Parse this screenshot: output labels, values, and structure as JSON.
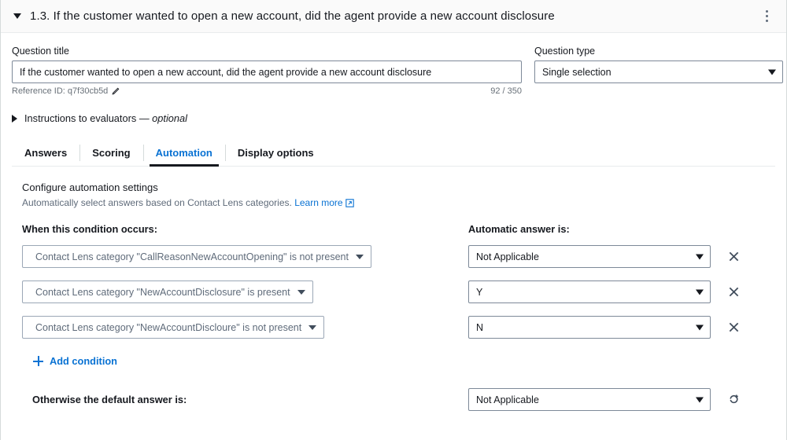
{
  "header": {
    "title": "1.3. If the customer wanted to open a new account, did the agent provide a new account disclosure",
    "collapse_icon": "caret-down-icon",
    "menu_icon": "kebab-menu-icon"
  },
  "question": {
    "title_label": "Question title",
    "title_value": "If the customer wanted to open a new account, did the agent provide a new account disclosure",
    "type_label": "Question type",
    "type_value": "Single selection",
    "reference_id": "Reference ID: q7f30cb5d",
    "edit_icon": "pencil-icon",
    "char_count": "92 / 350"
  },
  "instructions": {
    "label": "Instructions to evaluators — ",
    "optional": "optional",
    "expand_icon": "caret-right-icon"
  },
  "tabs": [
    {
      "label": "Answers",
      "active": false
    },
    {
      "label": "Scoring",
      "active": false
    },
    {
      "label": "Automation",
      "active": true
    },
    {
      "label": "Display options",
      "active": false
    }
  ],
  "automation": {
    "section_title": "Configure automation settings",
    "section_sub": "Automatically select answers based on Contact Lens categories. ",
    "learn_more": "Learn more",
    "external_link_icon": "external-link-icon",
    "condition_column_head": "When this condition occurs:",
    "answer_column_head": "Automatic answer is:",
    "rows": [
      {
        "condition": "Contact Lens category \"CallReasonNewAccountOpening\" is not present",
        "answer": "Not Applicable",
        "remove_icon": "close-icon"
      },
      {
        "condition": "Contact Lens category \"NewAccountDisclosure\" is present",
        "answer": "Y",
        "remove_icon": "close-icon"
      },
      {
        "condition": "Contact Lens category \"NewAccountDiscloure\" is not present",
        "answer": "N",
        "remove_icon": "close-icon"
      }
    ],
    "add_condition": "Add condition",
    "add_icon": "plus-icon",
    "default_label": "Otherwise the default answer is:",
    "default_answer": "Not Applicable",
    "reset_icon": "redo-icon"
  },
  "colors": {
    "accent_link": "#0972d3",
    "text_primary": "#16191f",
    "text_secondary": "#5f6b7a",
    "border": "#7d8998",
    "header_bg": "#fafafa",
    "active_tab_underline": "#16191f"
  }
}
